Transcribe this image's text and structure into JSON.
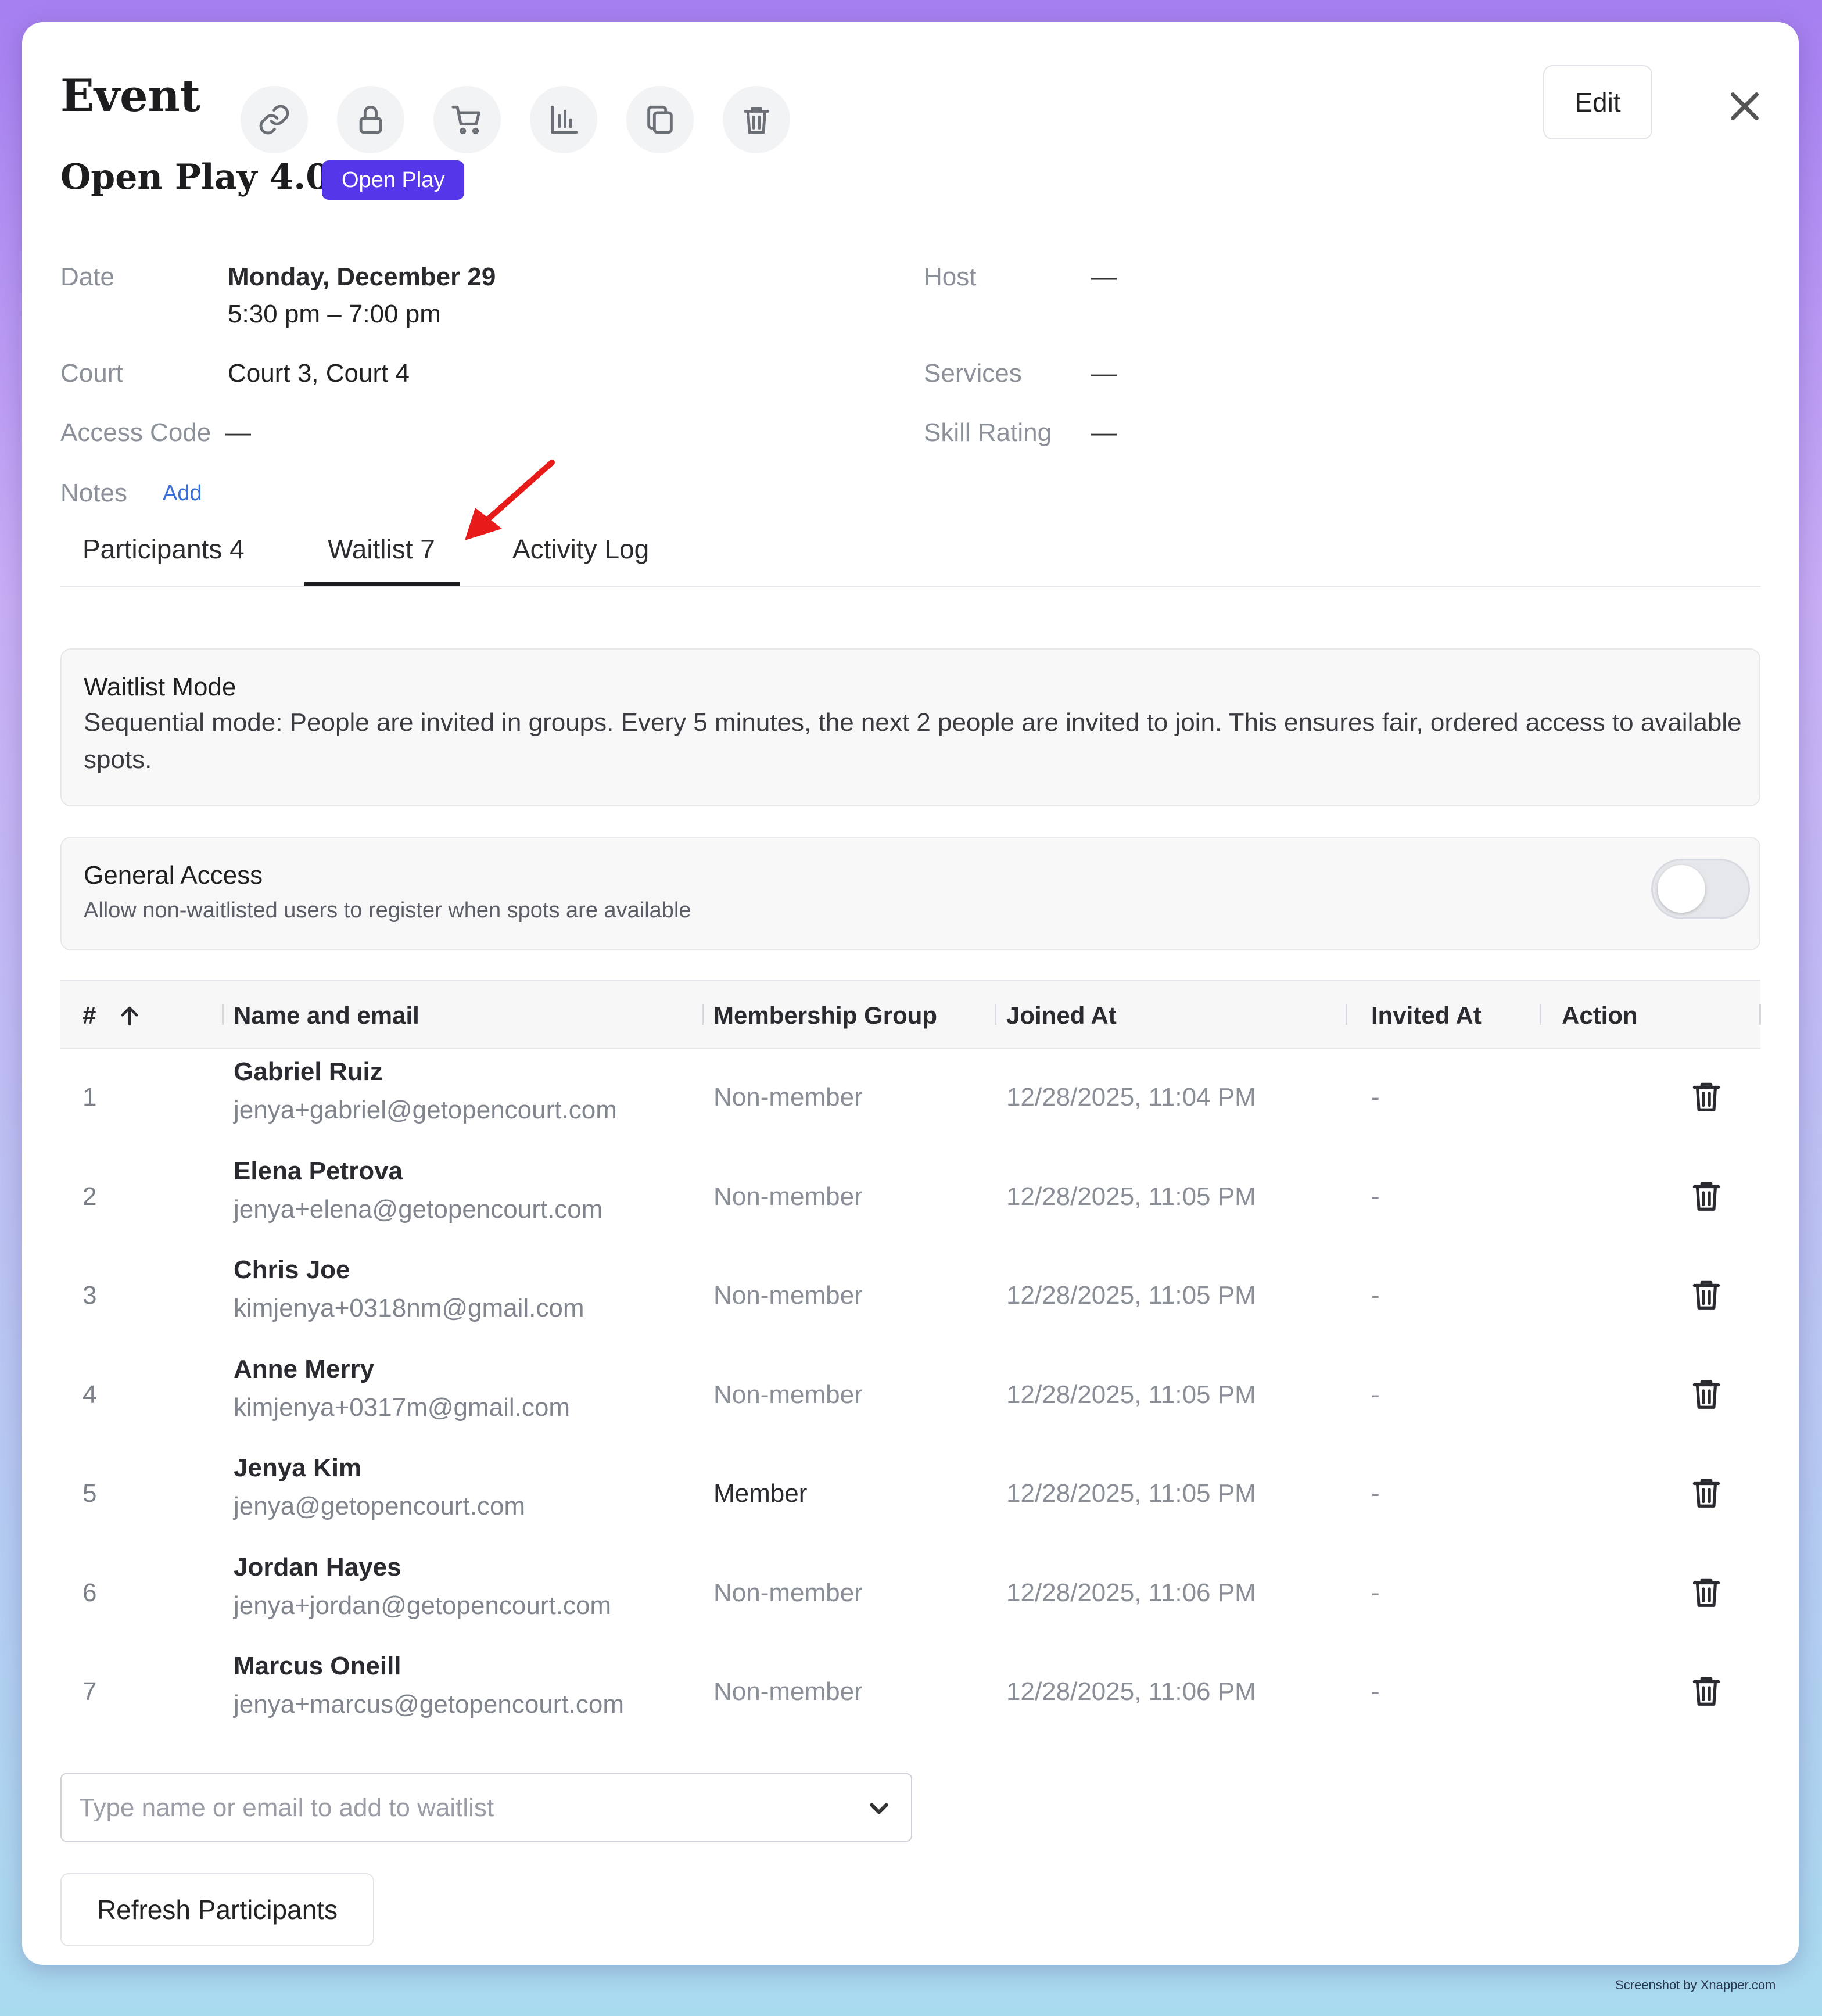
{
  "header": {
    "title": "Event",
    "edit_label": "Edit",
    "toolbar_icons": [
      "link-icon",
      "lock-icon",
      "cart-icon",
      "chart-icon",
      "copy-icon",
      "trash-icon"
    ]
  },
  "event": {
    "name": "Open Play 4.0",
    "badge": "Open Play",
    "badge_color": "#5536e8"
  },
  "details": {
    "date_label": "Date",
    "date_value": "Monday, December 29",
    "time_value": "5:30 pm – 7:00 pm",
    "court_label": "Court",
    "court_value": "Court 3, Court 4",
    "access_label": "Access Code",
    "access_value": "—",
    "notes_label": "Notes",
    "notes_add": "Add",
    "host_label": "Host",
    "host_value": "—",
    "services_label": "Services",
    "services_value": "—",
    "skill_label": "Skill Rating",
    "skill_value": "—"
  },
  "tabs": [
    {
      "label": "Participants 4",
      "active": false
    },
    {
      "label": "Waitlist 7",
      "active": true
    },
    {
      "label": "Activity Log",
      "active": false
    }
  ],
  "waitlist_mode": {
    "title": "Waitlist Mode",
    "text": "Sequential mode: People are invited in groups. Every 5 minutes, the next 2 people are invited to join. This ensures fair, ordered access to available spots."
  },
  "general_access": {
    "title": "General Access",
    "description": "Allow non-waitlisted users to register when spots are available",
    "enabled": false
  },
  "table": {
    "headers": [
      "#",
      "Name and email",
      "Membership Group",
      "Joined At",
      "Invited At",
      "Action"
    ],
    "rows": [
      {
        "num": "1",
        "name": "Gabriel Ruiz",
        "email": "jenya+gabriel@getopencourt.com",
        "group": "Non-member",
        "joined": "12/28/2025, 11:04 PM",
        "invited": "-"
      },
      {
        "num": "2",
        "name": "Elena Petrova",
        "email": "jenya+elena@getopencourt.com",
        "group": "Non-member",
        "joined": "12/28/2025, 11:05 PM",
        "invited": "-"
      },
      {
        "num": "3",
        "name": "Chris Joe",
        "email": "kimjenya+0318nm@gmail.com",
        "group": "Non-member",
        "joined": "12/28/2025, 11:05 PM",
        "invited": "-"
      },
      {
        "num": "4",
        "name": "Anne Merry",
        "email": "kimjenya+0317m@gmail.com",
        "group": "Non-member",
        "joined": "12/28/2025, 11:05 PM",
        "invited": "-"
      },
      {
        "num": "5",
        "name": "Jenya Kim",
        "email": "jenya@getopencourt.com",
        "group": "Member",
        "joined": "12/28/2025, 11:05 PM",
        "invited": "-"
      },
      {
        "num": "6",
        "name": "Jordan Hayes",
        "email": "jenya+jordan@getopencourt.com",
        "group": "Non-member",
        "joined": "12/28/2025, 11:06 PM",
        "invited": "-"
      },
      {
        "num": "7",
        "name": "Marcus Oneill",
        "email": "jenya+marcus@getopencourt.com",
        "group": "Non-member",
        "joined": "12/28/2025, 11:06 PM",
        "invited": "-"
      }
    ]
  },
  "add_waitlist": {
    "placeholder": "Type name or email to add to waitlist",
    "value": ""
  },
  "refresh_label": "Refresh Participants",
  "watermark": "Screenshot by Xnapper.com"
}
